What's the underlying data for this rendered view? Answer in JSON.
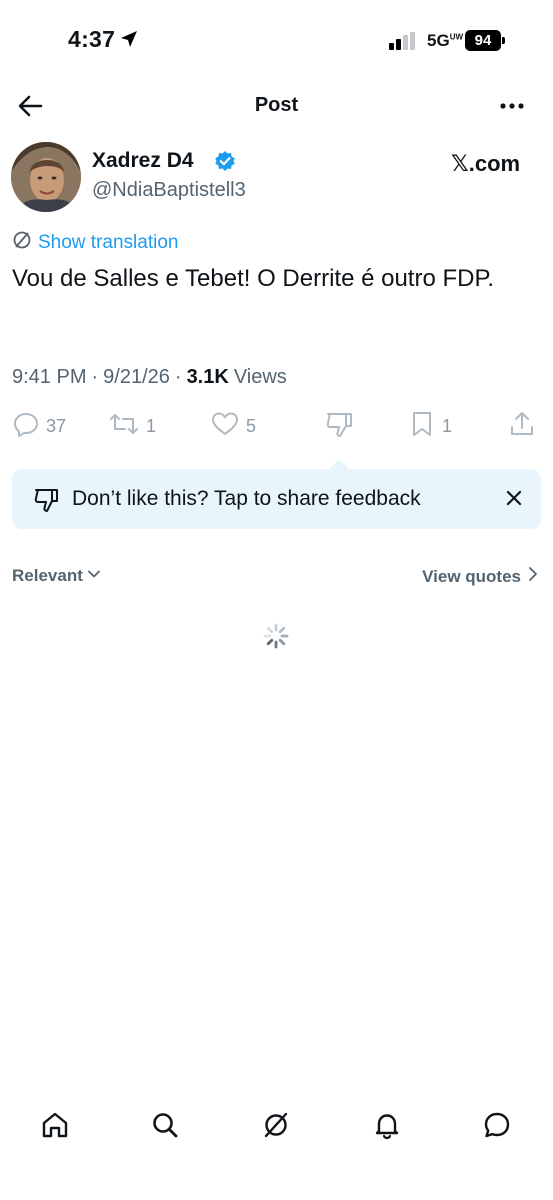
{
  "status_bar": {
    "time": "4:37",
    "network": "5G",
    "network_sup": "UW",
    "battery": "94"
  },
  "nav": {
    "title": "Post",
    "back_icon": "arrow-left-icon",
    "more_icon": "more-horizontal-icon"
  },
  "author": {
    "display_name": "Xadrez D4",
    "handle": "@NdiaBaptistell3",
    "verified": true,
    "source_label": "𝕏.com"
  },
  "tweet": {
    "translation_label": "Show translation",
    "text": "Vou de Salles e Tebet! O Derrite é outro FDP.",
    "time": "9:41 PM",
    "date": "9/21/26",
    "views_count": "3.1K",
    "views_label": "Views"
  },
  "actions": {
    "replies": "37",
    "reposts": "1",
    "likes": "5",
    "bookmarks": "1"
  },
  "feedback": {
    "text": "Don’t like this? Tap to share feedback"
  },
  "replies_header": {
    "sort_label": "Relevant",
    "quotes_label": "View quotes"
  },
  "bottom_nav": {
    "tabs": [
      "home-icon",
      "search-icon",
      "grok-icon",
      "notifications-icon",
      "messages-icon"
    ]
  },
  "colors": {
    "accent": "#1d9bf0",
    "secondary_text": "#536471",
    "feedback_bg": "#e8f5fd"
  }
}
